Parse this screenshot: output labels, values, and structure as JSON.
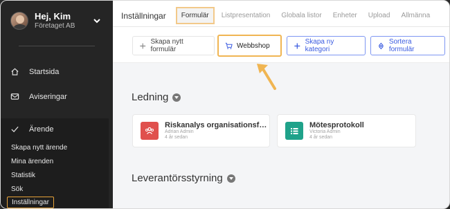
{
  "user": {
    "name": "Hej, Kim",
    "company": "Företaget AB"
  },
  "sidebar": {
    "items": [
      {
        "label": "Startsida",
        "icon": "home-icon"
      },
      {
        "label": "Aviseringar",
        "icon": "envelope-icon"
      },
      {
        "label": "Ärende",
        "icon": "check-icon"
      }
    ],
    "sub_items": [
      "Skapa nytt ärende",
      "Mina ärenden",
      "Statistik",
      "Sök",
      "Inställningar"
    ]
  },
  "topbar": {
    "title": "Inställningar",
    "tabs": [
      "Formulär",
      "Listpresentation",
      "Globala listor",
      "Enheter",
      "Upload",
      "Allmänna"
    ],
    "active_tab": "Formulär"
  },
  "actions": {
    "new_form": "Skapa nytt formulär",
    "webshop": "Webbshop",
    "new_category": "Skapa ny kategori",
    "sort_forms": "Sortera formulär"
  },
  "groups": [
    {
      "title": "Ledning",
      "cards": [
        {
          "title": "Riskanalys organisationsförän...",
          "author": "Adrian Admin",
          "time": "4 år sedan",
          "icon": "people-icon",
          "color": "#e0504d"
        },
        {
          "title": "Mötesprotokoll",
          "author": "Victoria Admin",
          "time": "4 år sedan",
          "icon": "list-icon",
          "color": "#1fa28a"
        }
      ]
    },
    {
      "title": "Leverantörsstyrning",
      "cards": []
    }
  ],
  "colors": {
    "accent_orange": "#f0b552",
    "accent_blue": "#3a5be0"
  }
}
